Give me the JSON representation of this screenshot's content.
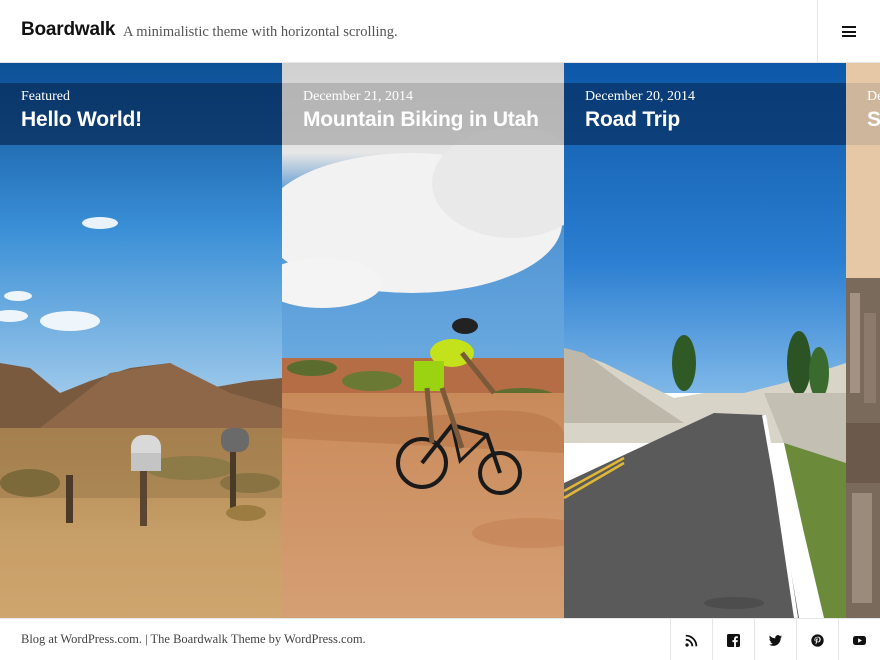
{
  "header": {
    "site_title": "Boardwalk",
    "site_description": "A minimalistic theme with horizontal scrolling."
  },
  "posts": [
    {
      "meta": "Featured",
      "title": "Hello World!"
    },
    {
      "meta": "December 21, 2014",
      "title": "Mountain Biking in Utah"
    },
    {
      "meta": "December 20, 2014",
      "title": "Road Trip"
    },
    {
      "meta": "December",
      "title": "St"
    }
  ],
  "footer": {
    "blog_link": "Blog at WordPress.com.",
    "separator": " | ",
    "theme_credit": "The Boardwalk Theme by WordPress.com."
  },
  "social": {
    "icons": [
      "rss-icon",
      "facebook-icon",
      "twitter-icon",
      "pinterest-icon",
      "youtube-icon"
    ]
  },
  "colors": {
    "header_overlay_dark": "#0b3563",
    "header_overlay_light": "#c8c8c8",
    "sky_blue": "#1f6fb5",
    "sand": "#c99a5c"
  }
}
